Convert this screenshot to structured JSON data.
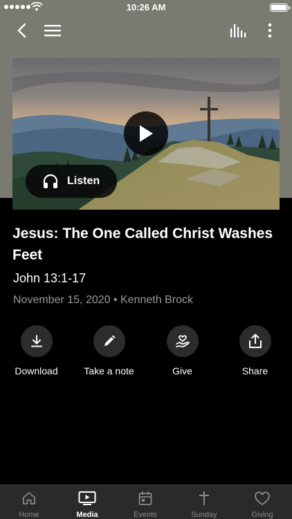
{
  "status_bar": {
    "time": "10:26 AM"
  },
  "sermon": {
    "title": "Jesus: The One Called Christ Washes Feet",
    "scripture": "John 13:1-17",
    "meta": "November 15, 2020 • Kenneth Brock"
  },
  "player": {
    "listen_label": "Listen"
  },
  "actions": [
    {
      "label": "Download",
      "icon": "download-icon"
    },
    {
      "label": "Take a note",
      "icon": "pencil-icon"
    },
    {
      "label": "Give",
      "icon": "give-heart-hand-icon"
    },
    {
      "label": "Share",
      "icon": "share-icon"
    }
  ],
  "tabs": [
    {
      "label": "Home",
      "icon": "home-icon",
      "active": false
    },
    {
      "label": "Media",
      "icon": "media-play-icon",
      "active": true
    },
    {
      "label": "Events",
      "icon": "calendar-icon",
      "active": false
    },
    {
      "label": "Sunday",
      "icon": "cross-icon",
      "active": false
    },
    {
      "label": "Giving",
      "icon": "heart-icon",
      "active": false
    }
  ],
  "colors": {
    "background": "#000000",
    "header_bg": "#7b7a71",
    "tab_bar_bg": "#2a2a2a",
    "muted_text": "#9a9a9a"
  }
}
